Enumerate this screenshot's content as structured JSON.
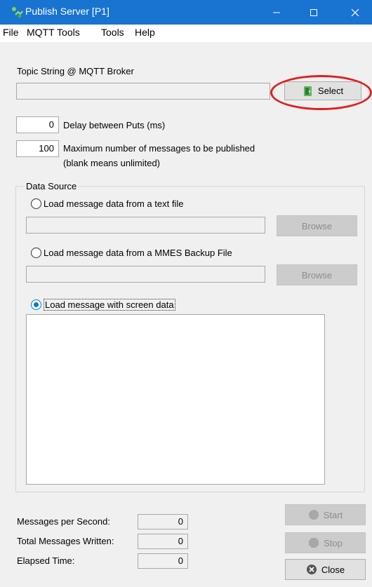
{
  "window": {
    "title": "Publish Server [P1]"
  },
  "menu": {
    "items": [
      "File",
      "MQTT Tools",
      "Tools",
      "Help"
    ]
  },
  "topic": {
    "label": "Topic String @ MQTT Broker",
    "value": "",
    "select_label": "Select"
  },
  "delay": {
    "value": "0",
    "label": "Delay between Puts (ms)"
  },
  "max_messages": {
    "value": "100",
    "label_line1": "Maximum number of messages to be published",
    "label_line2": "(blank means unlimited)"
  },
  "data_source": {
    "legend": "Data Source",
    "option_text_file": "Load message data from a text file",
    "option_backup_file": "Load message data from a MMES Backup File",
    "option_screen": "Load message with screen data",
    "selected": "screen",
    "browse_label": "Browse",
    "text_file_path": "",
    "backup_file_path": "",
    "screen_data": ""
  },
  "stats": {
    "messages_per_second_label": "Messages per Second:",
    "messages_per_second": "0",
    "total_written_label": "Total Messages Written:",
    "total_written": "0",
    "elapsed_label": "Elapsed Time:",
    "elapsed": "0"
  },
  "actions": {
    "start_label": "Start",
    "stop_label": "Stop",
    "close_label": "Close"
  },
  "icons": {
    "app": "app-icon",
    "select": "select-icon",
    "start": "start-icon",
    "stop": "stop-icon",
    "close": "close-icon"
  },
  "colors": {
    "titlebar": "#1973d1",
    "highlight": "#e0201f",
    "radio_selected": "#0078d7"
  }
}
